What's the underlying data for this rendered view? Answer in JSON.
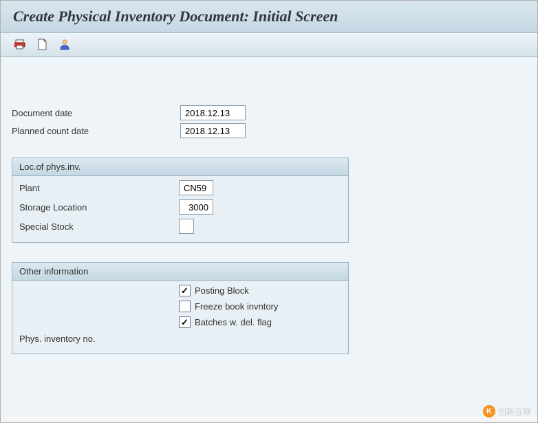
{
  "header": {
    "title": "Create Physical Inventory Document: Initial Screen"
  },
  "toolbar": {
    "icons": [
      "print-icon",
      "document-icon",
      "user-icon"
    ]
  },
  "dates": {
    "document_date_label": "Document date",
    "document_date_value": "2018.12.13",
    "planned_count_label": "Planned count date",
    "planned_count_value": "2018.12.13"
  },
  "loc_group": {
    "title": "Loc.of phys.inv.",
    "plant_label": "Plant",
    "plant_value": "CN59",
    "storage_label": "Storage Location",
    "storage_value": "3000",
    "special_label": "Special Stock",
    "special_value": ""
  },
  "other_group": {
    "title": "Other information",
    "posting_block_label": "Posting Block",
    "posting_block_checked": true,
    "freeze_book_label": "Freeze book invntory",
    "freeze_book_checked": false,
    "batches_label": "Batches w. del. flag",
    "batches_checked": true,
    "phys_inv_no_label": "Phys. inventory no.",
    "phys_inv_no_value": ""
  },
  "watermark": {
    "text": "创新互联"
  }
}
